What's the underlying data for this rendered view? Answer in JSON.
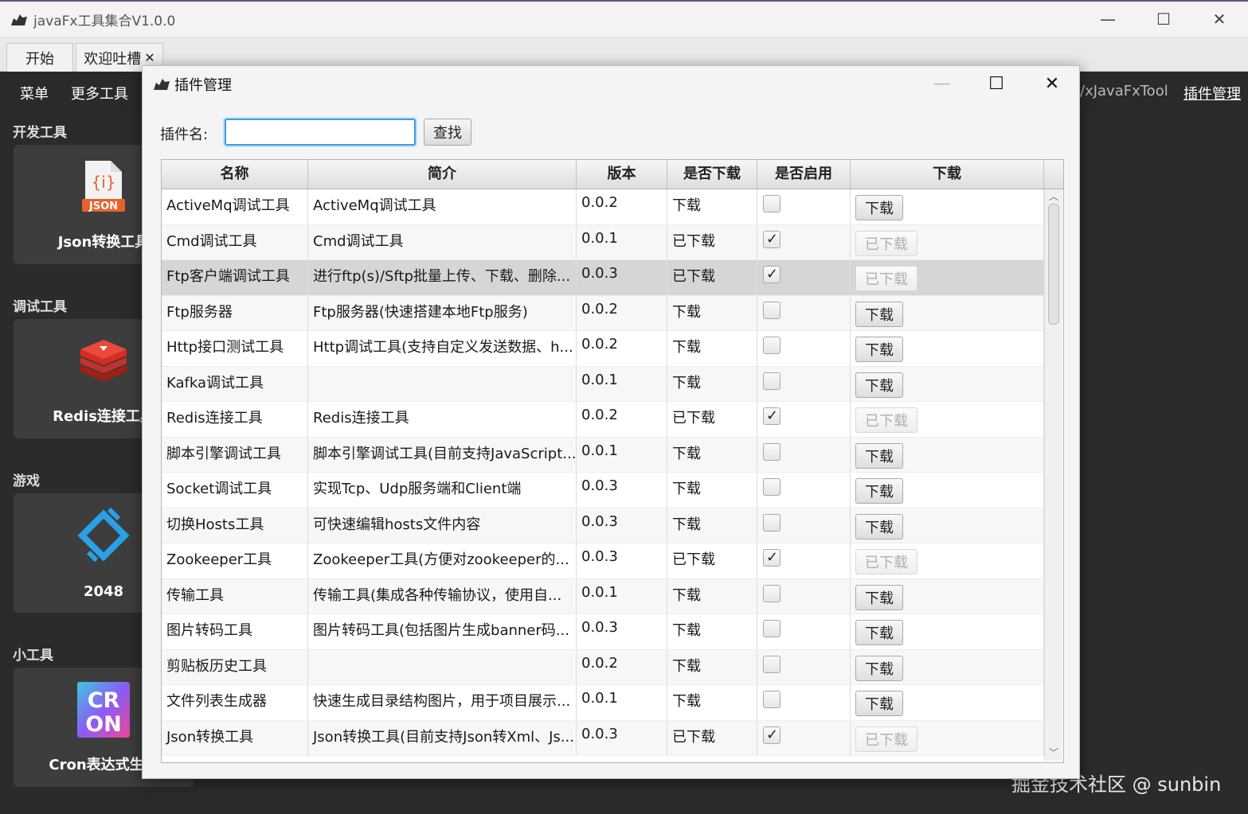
{
  "window": {
    "title": "javaFx工具集合V1.0.0",
    "minimize": "—",
    "maximize": "☐",
    "close": "✕"
  },
  "tabs": [
    {
      "label": "开始"
    },
    {
      "label": "欢迎吐槽",
      "close": "✕"
    }
  ],
  "menubar": {
    "menu": "菜单",
    "more_tools": "更多工具",
    "link": "/xJavaFxTool",
    "plugin_mgmt": "插件管理"
  },
  "sidebar": {
    "sections": [
      {
        "title": "开发工具",
        "card": "Json转换工具"
      },
      {
        "title": "调试工具",
        "card": "Redis连接工具"
      },
      {
        "title": "游戏",
        "card": "2048"
      },
      {
        "title": "小工具",
        "card": "Cron表达式生成"
      }
    ],
    "json_icon_text": "JSON",
    "cron_icon_text": [
      "CR",
      "ON"
    ]
  },
  "dialog": {
    "title": "插件管理",
    "minimize": "—",
    "maximize": "☐",
    "close": "✕",
    "search_label": "插件名:",
    "search_value": "",
    "search_button": "查找"
  },
  "table": {
    "headers": [
      "名称",
      "简介",
      "版本",
      "是否下载",
      "是否启用",
      "下载"
    ],
    "rows": [
      {
        "name": "ActiveMq调试工具",
        "desc": "ActiveMq调试工具",
        "ver": "0.0.2",
        "status": "下载",
        "enabled": false,
        "btn": "下载"
      },
      {
        "name": "Cmd调试工具",
        "desc": "Cmd调试工具",
        "ver": "0.0.1",
        "status": "已下载",
        "enabled": true,
        "btn": "已下载"
      },
      {
        "name": "Ftp客户端调试工具",
        "desc": "进行ftp(s)/Sftp批量上传、下载、删除...",
        "ver": "0.0.3",
        "status": "已下载",
        "enabled": true,
        "btn": "已下载"
      },
      {
        "name": "Ftp服务器",
        "desc": "Ftp服务器(快速搭建本地Ftp服务)",
        "ver": "0.0.2",
        "status": "下载",
        "enabled": false,
        "btn": "下载"
      },
      {
        "name": "Http接口测试工具",
        "desc": "Http调试工具(支持自定义发送数据、h...",
        "ver": "0.0.2",
        "status": "下载",
        "enabled": false,
        "btn": "下载"
      },
      {
        "name": "Kafka调试工具",
        "desc": "",
        "ver": "0.0.1",
        "status": "下载",
        "enabled": false,
        "btn": "下载"
      },
      {
        "name": "Redis连接工具",
        "desc": "Redis连接工具",
        "ver": "0.0.2",
        "status": "已下载",
        "enabled": true,
        "btn": "已下载"
      },
      {
        "name": "脚本引擎调试工具",
        "desc": "脚本引擎调试工具(目前支持JavaScript...",
        "ver": "0.0.1",
        "status": "下载",
        "enabled": false,
        "btn": "下载"
      },
      {
        "name": "Socket调试工具",
        "desc": "实现Tcp、Udp服务端和Client端",
        "ver": "0.0.3",
        "status": "下载",
        "enabled": false,
        "btn": "下载"
      },
      {
        "name": "切换Hosts工具",
        "desc": "可快速编辑hosts文件内容",
        "ver": "0.0.3",
        "status": "下载",
        "enabled": false,
        "btn": "下载"
      },
      {
        "name": "Zookeeper工具",
        "desc": "Zookeeper工具(方便对zookeeper的...",
        "ver": "0.0.3",
        "status": "已下载",
        "enabled": true,
        "btn": "已下载"
      },
      {
        "name": "传输工具",
        "desc": "传输工具(集成各种传输协议，使用自...",
        "ver": "0.0.1",
        "status": "下载",
        "enabled": false,
        "btn": "下载"
      },
      {
        "name": "图片转码工具",
        "desc": "图片转码工具(包括图片生成banner码...",
        "ver": "0.0.3",
        "status": "下载",
        "enabled": false,
        "btn": "下载"
      },
      {
        "name": "剪贴板历史工具",
        "desc": "",
        "ver": "0.0.2",
        "status": "下载",
        "enabled": false,
        "btn": "下载"
      },
      {
        "name": "文件列表生成器",
        "desc": "快速生成目录结构图片，用于项目展示...",
        "ver": "0.0.1",
        "status": "下载",
        "enabled": false,
        "btn": "下载"
      },
      {
        "name": "Json转换工具",
        "desc": "Json转换工具(目前支持Json转Xml、Js...",
        "ver": "0.0.3",
        "status": "已下载",
        "enabled": true,
        "btn": "已下载"
      }
    ],
    "selected_row": 2
  },
  "watermark": "掘金技术社区 @ sunbin",
  "colors": {
    "focus": "#3c9fe0",
    "dark_bg": "#2b2b2b",
    "card_bg": "#3d3d3d"
  }
}
